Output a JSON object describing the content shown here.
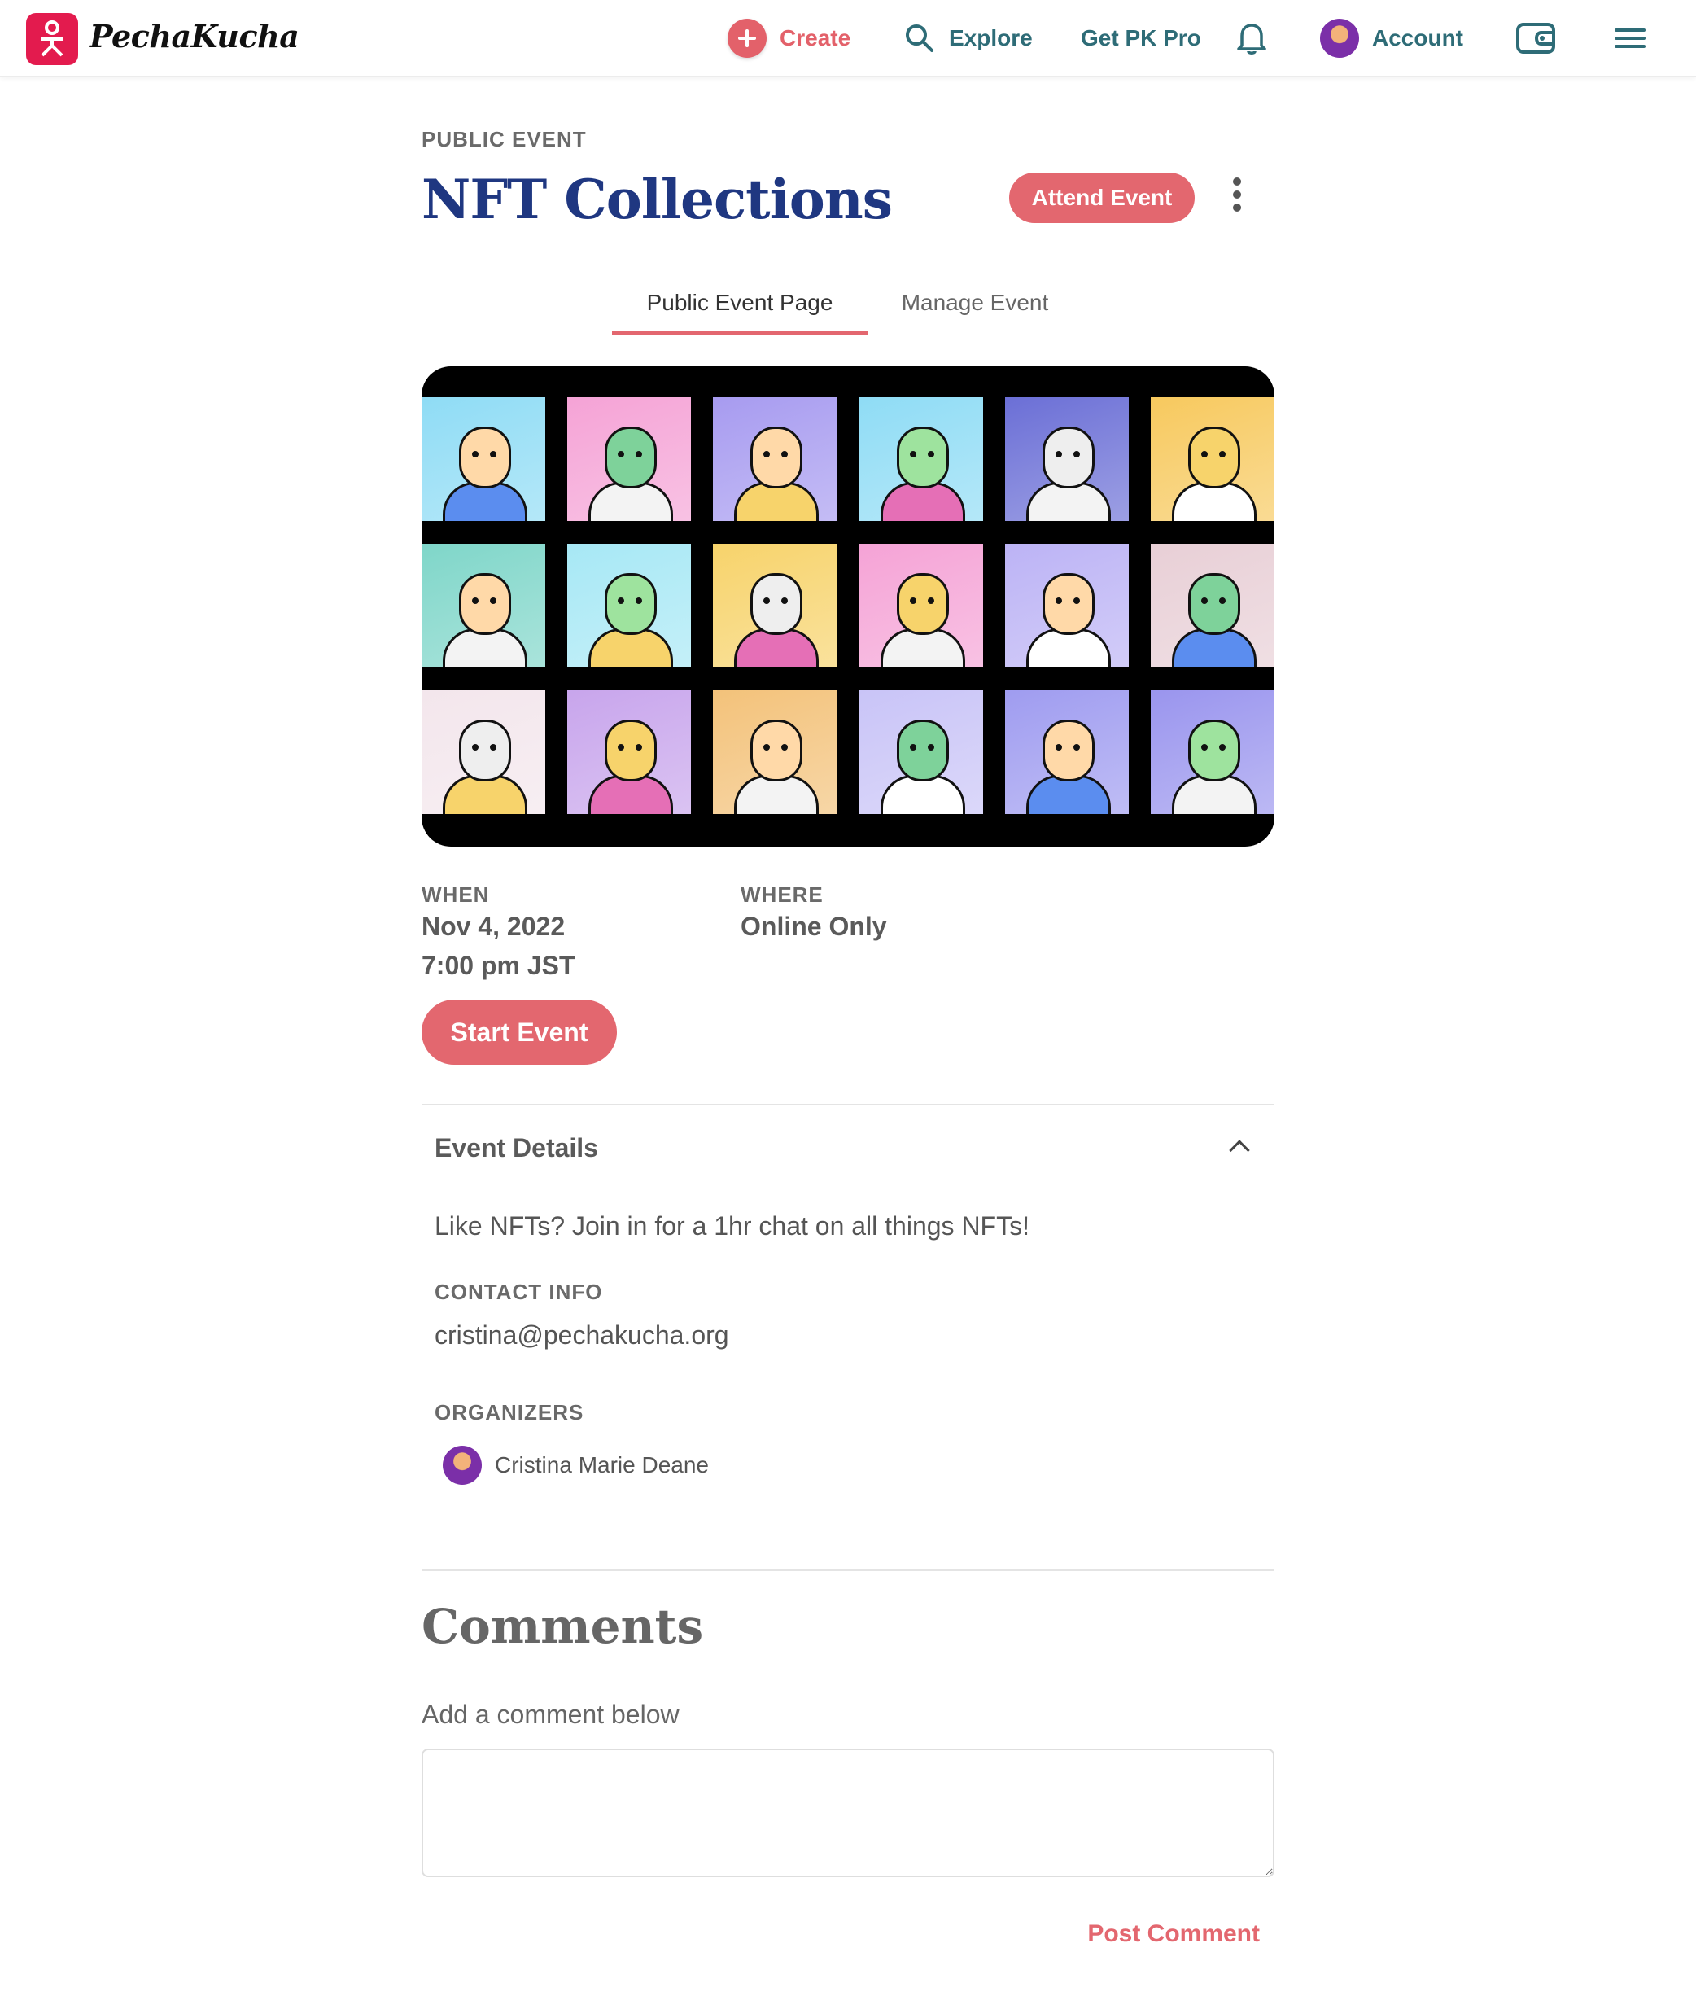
{
  "header": {
    "brand": "PechaKucha",
    "nav": {
      "create": "Create",
      "explore": "Explore",
      "pro": "Get PK Pro",
      "account": "Account"
    }
  },
  "event": {
    "eyebrow": "PUBLIC EVENT",
    "title": "NFT Collections",
    "attend_label": "Attend Event",
    "tabs": [
      {
        "label": "Public Event Page",
        "active": true
      },
      {
        "label": "Manage Event",
        "active": false
      }
    ],
    "when_label": "WHEN",
    "date": "Nov 4, 2022",
    "time": "7:00 pm JST",
    "where_label": "WHERE",
    "location": "Online Only",
    "start_label": "Start Event"
  },
  "details": {
    "title": "Event Details",
    "description": "Like NFTs? Join in for a 1hr chat on all things NFTs!",
    "contact_label": "CONTACT INFO",
    "contact_value": "cristina@pechakucha.org",
    "organizers_label": "ORGANIZERS",
    "organizers": [
      {
        "name": "Cristina Marie Deane"
      }
    ]
  },
  "comments": {
    "title": "Comments",
    "prompt": "Add a comment below",
    "placeholder": "",
    "post_label": "Post Comment"
  },
  "colors": {
    "accent": "#e3676f",
    "brand": "#e31b4e",
    "title": "#1f3781",
    "nav": "#2e6c77"
  }
}
